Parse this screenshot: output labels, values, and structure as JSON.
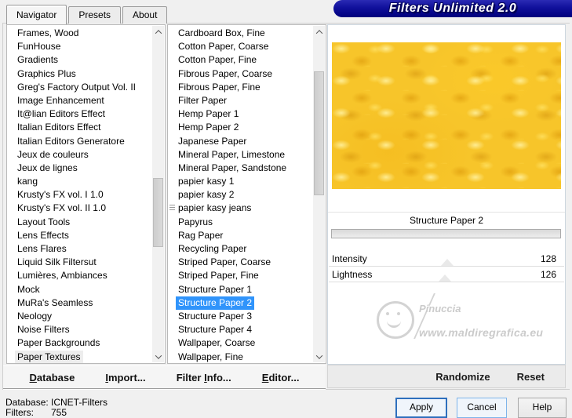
{
  "window": {
    "title": "Filters Unlimited 2.0"
  },
  "colors": {
    "title_bar": "#10109b",
    "selection": "#3094fb",
    "preview_base": "#f7c52a",
    "watermark": "#cfcfcf"
  },
  "tabs": [
    {
      "label": "Navigator",
      "active": true
    },
    {
      "label": "Presets",
      "active": false
    },
    {
      "label": "About",
      "active": false
    }
  ],
  "categories": {
    "items": [
      {
        "label": "Frames, Wood"
      },
      {
        "label": "FunHouse"
      },
      {
        "label": "Gradients"
      },
      {
        "label": "Graphics Plus"
      },
      {
        "label": "Greg's Factory Output Vol. II"
      },
      {
        "label": "Image Enhancement"
      },
      {
        "label": "It@lian Editors Effect"
      },
      {
        "label": "Italian Editors Effect"
      },
      {
        "label": "Italian Editors Generatore"
      },
      {
        "label": "Jeux de couleurs"
      },
      {
        "label": "Jeux de lignes"
      },
      {
        "label": "kang"
      },
      {
        "label": "Krusty's FX vol. I 1.0"
      },
      {
        "label": "Krusty's FX vol. II 1.0"
      },
      {
        "label": "Layout Tools"
      },
      {
        "label": "Lens Effects"
      },
      {
        "label": "Lens Flares"
      },
      {
        "label": "Liquid Silk Filtersut"
      },
      {
        "label": "Lumières, Ambiances"
      },
      {
        "label": "Mock"
      },
      {
        "label": "MuRa's Seamless"
      },
      {
        "label": "Neology"
      },
      {
        "label": "Noise Filters"
      },
      {
        "label": "Paper Backgrounds"
      },
      {
        "label": "Paper Textures",
        "catsel": true
      }
    ]
  },
  "filters": {
    "items": [
      {
        "label": "Cardboard Box, Fine"
      },
      {
        "label": "Cotton Paper, Coarse"
      },
      {
        "label": "Cotton Paper, Fine"
      },
      {
        "label": "Fibrous Paper, Coarse"
      },
      {
        "label": "Fibrous Paper, Fine"
      },
      {
        "label": "Filter Paper"
      },
      {
        "label": "Hemp Paper 1"
      },
      {
        "label": "Hemp Paper 2"
      },
      {
        "label": "Japanese Paper"
      },
      {
        "label": "Mineral Paper, Limestone"
      },
      {
        "label": "Mineral Paper, Sandstone"
      },
      {
        "label": "papier kasy 1"
      },
      {
        "label": "papier kasy 2"
      },
      {
        "label": "papier kasy jeans",
        "marker": true
      },
      {
        "label": "Papyrus"
      },
      {
        "label": "Rag Paper"
      },
      {
        "label": "Recycling Paper"
      },
      {
        "label": "Striped Paper, Coarse"
      },
      {
        "label": "Striped Paper, Fine"
      },
      {
        "label": "Structure Paper 1"
      },
      {
        "label": "Structure Paper 2",
        "selected": true
      },
      {
        "label": "Structure Paper 3"
      },
      {
        "label": "Structure Paper 4"
      },
      {
        "label": "Wallpaper, Coarse"
      },
      {
        "label": "Wallpaper, Fine"
      }
    ]
  },
  "preview": {
    "caption": "Structure Paper 2"
  },
  "sliders": [
    {
      "label": "Intensity",
      "value": 128,
      "max": 255
    },
    {
      "label": "Lightness",
      "value": 126,
      "max": 255
    }
  ],
  "watermark": {
    "name": "Pinuccia",
    "url": "www.maldiregrafica.eu"
  },
  "actions": {
    "randomize": "Randomize",
    "reset": "Reset",
    "database": {
      "pre": "",
      "key": "D",
      "post": "atabase"
    },
    "import": {
      "pre": "",
      "key": "I",
      "post": "mport..."
    },
    "filter_info": {
      "pre": "Filter ",
      "key": "I",
      "post": "nfo..."
    },
    "editor": {
      "pre": "",
      "key": "E",
      "post": "ditor..."
    },
    "apply": "Apply",
    "cancel": "Cancel",
    "help": "Help"
  },
  "status": {
    "database_label": "Database:",
    "database_value": "ICNET-Filters",
    "filters_label": "Filters:",
    "filters_value": "755"
  }
}
